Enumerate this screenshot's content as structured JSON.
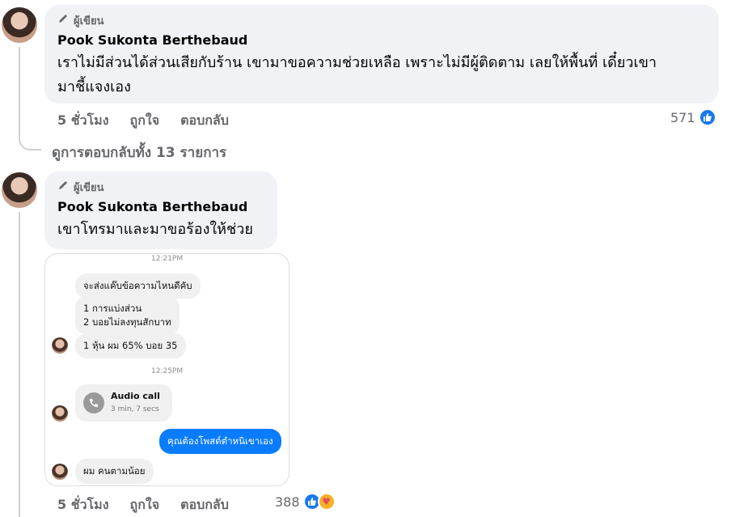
{
  "comments": [
    {
      "badge": "ผู้เขียน",
      "author": "Pook Sukonta Berthebaud",
      "lines": [
        "เราไม่มีส่วนได้ส่วนเสียกับร้าน เขามาขอความช่วยเหลือ เพราะไม่มีผู้ติดตาม เลยให้พื้นที่ เดี๋ยวเขา",
        "มาชี้แจงเอง"
      ],
      "time": "5 ชั่วโมง",
      "like": "ถูกใจ",
      "reply": "ตอบกลับ",
      "reactions": "571"
    },
    {
      "badge": "ผู้เขียน",
      "author": "Pook Sukonta Berthebaud",
      "lines": [
        "เขาโทรมาและมาขอร้องให้ช่วย"
      ],
      "time": "5 ชั่วโมง",
      "like": "ถูกใจ",
      "reply": "ตอบกลับ",
      "reactions": "388"
    }
  ],
  "view_replies": "ดูการตอบกลับทั้ง 13 รายการ",
  "chat": {
    "ts1": "12:21PM",
    "m1": "จะส่งแค๊บข้อความไหนดีคับ",
    "m2a": "1 การแบ่งส่วน",
    "m2b": "2 บอยไม่ลงทุนสักบาท",
    "m3": "1 หุ้น ผม 65% บอย 35",
    "ts2": "12:25PM",
    "call_title": "Audio call",
    "call_sub": "3 min, 7 secs",
    "me": "คุณต้องโพสต์ตำหนิเขาเอง",
    "m4": "ผม คนตามน้อย"
  },
  "icons": {
    "pencil": "pencil-icon",
    "like": "like-icon",
    "care": "care-icon",
    "phone": "phone-icon"
  },
  "colors": {
    "accent": "#1877f2",
    "bubble": "#f0f2f5",
    "messenger": "#0a7cff"
  }
}
